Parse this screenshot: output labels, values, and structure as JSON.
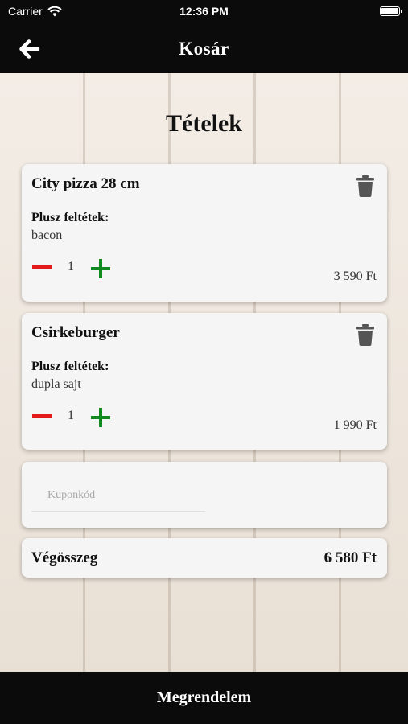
{
  "status_bar": {
    "carrier": "Carrier",
    "time": "12:36 PM"
  },
  "nav": {
    "title": "Kosár",
    "back_icon": "arrow-left-icon"
  },
  "section_title": "Tételek",
  "items": [
    {
      "name": "City pizza 28 cm",
      "extras_label": "Plusz feltétek:",
      "extras": "bacon",
      "quantity": "1",
      "price": "3 590 Ft"
    },
    {
      "name": "Csirkeburger",
      "extras_label": "Plusz feltétek:",
      "extras": "dupla sajt",
      "quantity": "1",
      "price": "1 990 Ft"
    }
  ],
  "coupon": {
    "placeholder": "Kuponkód",
    "value": ""
  },
  "total": {
    "label": "Végösszeg",
    "value": "6 580 Ft"
  },
  "order_button": {
    "label": "Megrendelem"
  },
  "colors": {
    "bar": "#0b0b0b",
    "minus": "#e21a1a",
    "plus": "#108a1f",
    "trash": "#555555",
    "card": "#f5f5f5"
  }
}
